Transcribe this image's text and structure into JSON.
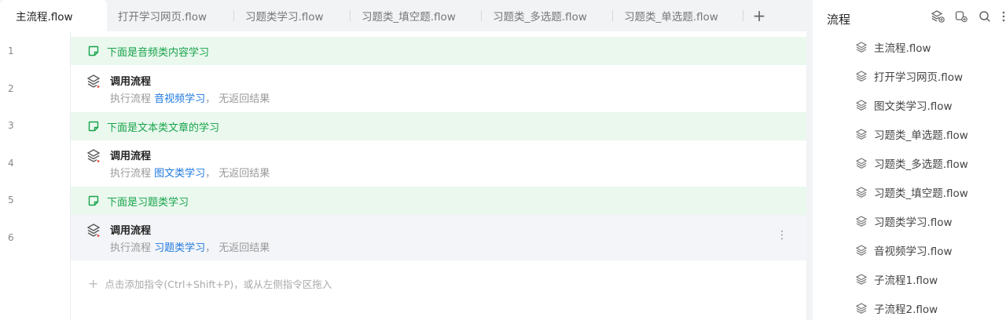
{
  "tabs": [
    {
      "label": "主流程.flow"
    },
    {
      "label": "打开学习网页.flow"
    },
    {
      "label": "习题类学习.flow"
    },
    {
      "label": "习题类_填空题.flow"
    },
    {
      "label": "习题类_多选题.flow"
    },
    {
      "label": "习题类_单选题.flow"
    }
  ],
  "tab_add": "+",
  "lines": [
    "1",
    "2",
    "3",
    "4",
    "5",
    "6"
  ],
  "rows": [
    {
      "type": "comment",
      "text": "下面是音频类内容学习"
    },
    {
      "type": "command",
      "title": "调用流程",
      "prefix": "执行流程",
      "link": "音视频学习",
      "suffix": "， 无返回结果"
    },
    {
      "type": "comment",
      "text": "下面是文本类文章的学习"
    },
    {
      "type": "command",
      "title": "调用流程",
      "prefix": "执行流程",
      "link": "图文类学习",
      "suffix": "， 无返回结果"
    },
    {
      "type": "comment",
      "text": "下面是习题类学习"
    },
    {
      "type": "command",
      "title": "调用流程",
      "prefix": "执行流程",
      "link": "习题类学习",
      "suffix": "， 无返回结果"
    }
  ],
  "more": "⋮",
  "add_hint": {
    "plus": "+",
    "text": "点击添加指令(Ctrl+Shift+P)，或从左侧指令区拖入"
  },
  "panel": {
    "title": "流程",
    "items": [
      "主流程.flow",
      "打开学习网页.flow",
      "图文类学习.flow",
      "习题类_单选题.flow",
      "习题类_多选题.flow",
      "习题类_填空题.flow",
      "习题类学习.flow",
      "音视频学习.flow",
      "子流程1.flow",
      "子流程2.flow"
    ]
  },
  "colors": {
    "comment_green": "#17a34a",
    "link_blue": "#1f7ae0",
    "comment_bg": "#eaf8ee"
  }
}
